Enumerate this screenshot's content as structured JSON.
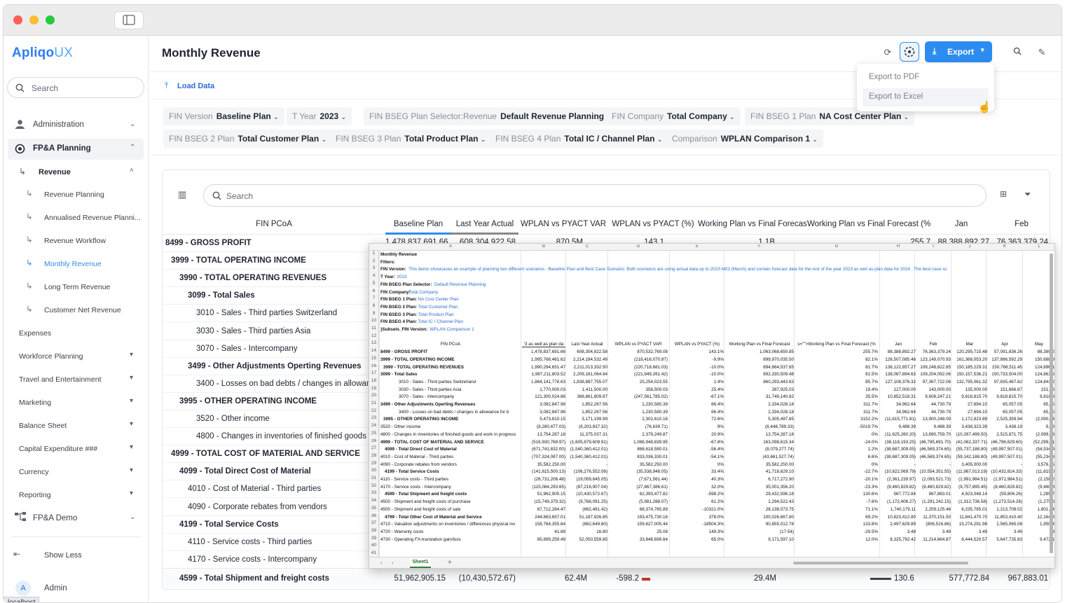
{
  "app": {
    "logo_main": "Apliqo",
    "logo_accent": "UX"
  },
  "sidebar": {
    "search_placeholder": "Search",
    "items": [
      {
        "label": "Administration"
      },
      {
        "label": "FP&A Planning"
      },
      {
        "label": "Revenue"
      },
      {
        "label": "Revenue Planning"
      },
      {
        "label": "Annualised Revenue Planni..."
      },
      {
        "label": "Revenue Workflow"
      },
      {
        "label": "Monthly Revenue"
      },
      {
        "label": "Long Term Revenue"
      },
      {
        "label": "Customer Net Revenue"
      },
      {
        "label": "Expenses"
      },
      {
        "label": "Workforce Planning"
      },
      {
        "label": "Travel and Entertainment"
      },
      {
        "label": "Marketing"
      },
      {
        "label": "Balance Sheet"
      },
      {
        "label": "Capital Expenditure ###"
      },
      {
        "label": "Currency"
      },
      {
        "label": "Reporting"
      },
      {
        "label": "FP&A Demo"
      }
    ],
    "show_less": "Show Less",
    "user_initial": "A",
    "user_name": "Admin"
  },
  "header": {
    "title": "Monthly Revenue",
    "export_label": "Export"
  },
  "export_menu": {
    "pdf": "Export to PDF",
    "excel": "Export to Excel"
  },
  "toolbar": {
    "load_data": "Load Data"
  },
  "filters": [
    {
      "key": "FIN Version",
      "value": "Baseline Plan"
    },
    {
      "key": "T Year",
      "value": "2023"
    },
    {
      "key": "FIN BSEG Plan Selector:Revenue",
      "value": "Default Revenue Planning"
    },
    {
      "key": "FIN Company",
      "value": "Total Company"
    },
    {
      "key": "FIN BSEG 1 Plan",
      "value": "NA Cost Center Plan"
    },
    {
      "key": "FIN BSEG 2 Plan",
      "value": "Total Customer Plan"
    },
    {
      "key": "FIN BSEG 3 Plan",
      "value": "Total Product Plan"
    },
    {
      "key": "FIN BSEG 4 Plan",
      "value": "Total IC / Channel Plan"
    },
    {
      "key": "Comparison",
      "value": "WPLAN Comparison 1"
    }
  ],
  "grid": {
    "search_placeholder": "Search",
    "columns": [
      "FIN PCoA",
      "Baseline Plan",
      "Last Year Actual",
      "WPLAN vs PYACT VAR",
      "WPLAN vs PYACT (%)",
      "Working Plan vs Final Forecast",
      "Working Plan vs Final Forecast (%)",
      "Jan",
      "Feb"
    ],
    "first_row_values": [
      "1,478,837,691.66",
      "608,304,922.58",
      "870.5M",
      "143.1",
      "1.1B",
      "255.7",
      "88,388,892.27",
      "76,363,379.24"
    ],
    "rows": [
      "8499 - GROSS PROFIT",
      "3999 - TOTAL OPERATING INCOME",
      "3990 - TOTAL OPERATING REVENUES",
      "3099 - Total Sales",
      "3010 - Sales - Third parties Switzerland",
      "3030 - Sales - Third parties Asia",
      "3070 - Sales - Intercompany",
      "3499 - Other Adjustments Operting Revenues",
      "3400 - Losses on bad debts / changes in allowance f",
      "3995 - OTHER OPERATING INCOME",
      "3520 - Other income",
      "4800 - Changes in inventories of finished goods and wo",
      "4999 - TOTAL COST OF MATERIAL AND SERVICE",
      "4099 - Total Direct Cost of Material",
      "4010 - Cost of Material - Third parties",
      "4090 - Corporate rebates from vendors",
      "4199 - Total Service Costs",
      "4110 - Service costs - Third parties",
      "4170 - Service costs - Intercompany",
      "4599 - Total Shipment and freight costs"
    ],
    "last_row_values": [
      "51,962,905.15",
      "(10,430,572.67)",
      "62.4M",
      "-598.2",
      "29.4M",
      "130.6",
      "577,772.84",
      "967,883.01"
    ]
  },
  "excel": {
    "title": "Monthly Revenue",
    "filters_label": "Filters:",
    "meta": [
      {
        "k": "FIN Version:",
        "v": "This demo showcases an example of planning two different scenarios - Baseline Plan and Best Case Scenario.  Both scenarios are using actual data up to 2023-M03 (March) and contain forecast data for the rest of the year 2023 as well as plan data for 2024 . The best case sc"
      },
      {
        "k": "T Year:",
        "v": "2023"
      },
      {
        "k": "FIN BSEG Plan Selector:",
        "v": "Default Revenue Planning"
      },
      {
        "k": "FIN Company:",
        "v": "Total Company"
      },
      {
        "k": "FIN BSEG 1 Plan:",
        "v": "NA Cost Center Plan"
      },
      {
        "k": "FIN BSEG 2 Plan:",
        "v": "Total Customer Plan"
      },
      {
        "k": "FIN BSEG 3 Plan:",
        "v": "Total Product Plan"
      },
      {
        "k": "FIN BSEG 4 Plan:",
        "v": "Total IC / Channel Plan"
      },
      {
        "k": "}Subsets_FIN Version:",
        "v": "WPLAN Comparison 1"
      }
    ],
    "col_letters": [
      "A",
      "B",
      "C",
      "D",
      "E",
      "F",
      "G",
      "H",
      "I",
      "J",
      "K",
      "L"
    ],
    "headers": [
      "FIN PCoA",
      "'3 as well as plan da",
      "Last Year Actual",
      "WPLAN vs PYACT VAR",
      "WPLAN vs PYACT (%)",
      "Working Plan vs Final Forecast",
      "s=\"\">Working Plan vs Final Forecast (%",
      "Jan",
      "Feb",
      "Mar",
      "Apr",
      "May"
    ],
    "rows": [
      [
        "8499 - GROSS PROFIT",
        "1,478,837,691.66",
        "608,304,922.58",
        "870,532,769.08",
        "143.1%",
        "1,063,068,650.85",
        "255.7%",
        "88,388,892.27",
        "76,363,379.24",
        "120,295,715.48",
        "57,091,836.26",
        "88,389,2"
      ],
      [
        "3999 - TOTAL OPERATING INCOME",
        "1,995,768,461.62",
        "2,214,184,532.49",
        "(218,416,070.87)",
        "-9.9%",
        "899,970,035.50",
        "82.1%",
        "126,507,085.46",
        "123,149,070.93",
        "161,368,053.20",
        "137,886,592.29",
        "150,688,9"
      ],
      [
        "3990 - TOTAL OPERATING REVENUES",
        "1,990,294,651.47",
        "2,211,013,332.50",
        "(220,718,681.03)",
        "-10.0%",
        "894,664,537.65",
        "81.7%",
        "138,122,857.27",
        "109,248,822.85",
        "150,185,229.31",
        "150,768,511.45",
        "124,896,1"
      ],
      [
        "3099 - Total Sales",
        "1,987,211,803.52",
        "2,209,161,064.94",
        "(221,949,261.42)",
        "-10.0%",
        "892,330,509.48",
        "81.5%",
        "138,087,894.63",
        "109,204,092.06",
        "150,157,536.21",
        "150,733,504.00",
        "124,861,5"
      ],
      [
        "3010 - Sales - Third parties Switzerland",
        "1,864,141,778.63",
        "1,838,887,755.07",
        "25,254,023.55",
        "1.4%",
        "860,293,443.63",
        "85.7%",
        "127,108,376.32",
        "97,367,722.06",
        "132,795,061.32",
        "97,835,467.62",
        "124,841,2"
      ],
      [
        "3030 - Sales - Third parties Asia",
        "1,770,000.03",
        "1,411,500.00",
        "358,500.03",
        "25.4%",
        "287,925.03",
        "19.4%",
        "127,000.00",
        "143,000.00",
        "135,000.00",
        "151,666.67",
        "151,66"
      ],
      [
        "3070 - Sales - Intercompany",
        "121,300,024.86",
        "368,861,809.87",
        "(247,561,785.02)",
        "-67.1%",
        "31,749,140.82",
        "35.5%",
        "10,852,518.31",
        "9,608,247.21",
        "9,818,815.70",
        "9,818,815.70",
        "9,818,8"
      ],
      [
        "3499 - Other Adjustments Operting Revenues",
        "3,082,847.96",
        "1,852,267.56",
        "1,230,580.39",
        "66.4%",
        "2,334,028.18",
        "311.7%",
        "34,962.64",
        "44,730.79",
        "27,694.10",
        "65,057.05",
        "65,05"
      ],
      [
        "3400 - Losses on bad debts / changes in allowance for b",
        "3,082,847.96",
        "1,852,267.56",
        "1,230,580.39",
        "66.4%",
        "2,334,028.18",
        "311.7%",
        "34,962.64",
        "44,730.79",
        "27,694.10",
        "65,057.05",
        "65,05"
      ],
      [
        "3995 - OTHER OPERATING INCOME",
        "5,473,810.15",
        "3,171,199.99",
        "2,302,610.16",
        "72.6%",
        "5,305,497.85",
        "3152.2%",
        "(11,615,771.81)",
        "13,900,248.09",
        "1,172,823.89",
        "2,525,359.94",
        "(2,090,14"
      ],
      [
        "3520 - Other income",
        "(8,280,477.03)",
        "(8,203,837.32)",
        "(76,639.71)",
        "9%",
        "(8,448,789.33)",
        "-5019.7%",
        "9,488.39",
        "9,488.39",
        "3,438,323.39",
        "3,438.19",
        "9,48"
      ],
      [
        "4800 - Changes in inventories of finished goods and work in progress",
        "13,754,287.18",
        "11,375,037.31",
        "2,379,249.87",
        "20.9%",
        "13,754,287.18",
        "0%",
        "(11,625,260.20)",
        "13,890,759.70",
        "(10,267,499.50)",
        "2,515,871.75",
        "(2,099,63"
      ],
      [
        "4999 - TOTAL COST OF MATERIAL AND SERVICE",
        "(516,930,769.97)",
        "(1,605,879,609.91)",
        "1,088,948,839.95",
        "-67.8%",
        "163,098,615.34",
        "-24.0%",
        "(38,118,193.25)",
        "(46,785,691.70)",
        "(41,062,337.71)",
        "(46,796,629.60)",
        "(52,299,71"
      ],
      [
        "4099 - Total Direct Cost of Material",
        "(671,741,832.00)",
        "(1,540,360,412.01)",
        "868,618,580.01",
        "-56.4%",
        "(8,079,277.74)",
        "1.2%",
        "(38,687,309.05)",
        "(46,569,374.65)",
        "(55,737,188.80)",
        "(49,997,507.01)",
        "(54,534,9"
      ],
      [
        "4010 - Cost of Material - Third parties",
        "(707,324,087.00)",
        "(1,540,360,412.01)",
        "833,036,330.01",
        "-54.1%",
        "(43,661,527.74)",
        "6.6%",
        "(38,687,309.05)",
        "(46,569,374.65)",
        "(59,142,188.80)",
        "(49,997,507.01)",
        "(55,234,9"
      ],
      [
        "4090 - Corporate rebates from vendors",
        "35,582,250.00",
        "-",
        "35,582,250.00",
        "0%",
        "35,582,250.00",
        "0%",
        "-",
        "-",
        "3,405,000.00",
        "-",
        "3,576,25"
      ],
      [
        "4199 - Total Service Costs",
        "(141,815,500.13)",
        "(106,276,552.08)",
        "(35,538,948.05)",
        "33.4%",
        "41,718,629.10",
        "-22.7%",
        "(10,822,069.79)",
        "(10,554,351.55)",
        "(11,967,013.19)",
        "(10,432,814.33)",
        "(11,619,0"
      ],
      [
        "4110 - Service costs - Third parties",
        "(26,731,206.48)",
        "(19,059,645.05)",
        "(7,671,561.44)",
        "40.3%",
        "6,717,272.90",
        "-20.1%",
        "(2,361,239.97)",
        "(2,093,521.73)",
        "(1,991,984.51)",
        "(1,971,984.51)",
        "(2,158,2"
      ],
      [
        "4170 - Service costs - Intercompany",
        "(115,084,293.65)",
        "(87,216,907.04)",
        "(27,867,386.61)",
        "32.0%",
        "35,001,356.20",
        "-23.3%",
        "(8,460,829.82)",
        "(8,460,829.82)",
        "(9,757,895.45)",
        "(8,460,829.82)",
        "(9,460,8"
      ],
      [
        "4599 - Total Shipment and freight costs",
        "51,962,905.15",
        "(10,430,572.67)",
        "62,393,477.82",
        "-598.2%",
        "29,432,596.18",
        "130.6%",
        "567,772.84",
        "967,883.01",
        "4,923,048.14",
        "(59,806.26)",
        "1,289,7"
      ],
      [
        "4500 - Shipment and freight costs of purchase",
        "(15,749,379.32)",
        "(9,768,091.25)",
        "(5,981,288.07)",
        "61.2%",
        "1,294,522.43",
        "-7.6%",
        "(1,172,406.27)",
        "(1,291,242.15)",
        "(1,312,736.58)",
        "(1,273,514.28)",
        "(1,275,6"
      ],
      [
        "4500 - Shipment and freight costs of sale",
        "67,712,284.47",
        "(662,481.42)",
        "68,374,765.89",
        "-10321.0%",
        "28,138,073.75",
        "71.1%",
        "1,740,179.11",
        "2,259,125.48",
        "6,235,785.01",
        "1,213,708.02",
        "1,801,74"
      ],
      [
        "4799 - Total Other Cost of Material and Service",
        "244,663,657.01",
        "51,187,926.85",
        "193,475,730.16",
        "378.0%",
        "100,026,667.80",
        "69.2%",
        "10,823,412.80",
        "11,370,151.50",
        "11,841,470.70",
        "11,853,410.40",
        "12,164,8"
      ],
      [
        "4710 - Valuation adjustments on inventories / differences physical inv",
        "158,764,355.64",
        "(862,649.80)",
        "159,627,005.44",
        "-18504.3%",
        "90,855,012.78",
        "133.8%",
        "2,497,629.89",
        "(806,516.86)",
        "15,274,291.98",
        "2,565,065.08",
        "1,950,4"
      ],
      [
        "4720 - Warranty costs",
        "41.88",
        "16.80",
        "25.08",
        "149.3%",
        "(17.54)",
        "-29.5%",
        "3.49",
        "3.49",
        "3.49",
        "3.49",
        "3"
      ],
      [
        "4730 - Operating FX-translation gain/loss",
        "85,899,259.49",
        "52,050,559.85",
        "33,848,699.64",
        "65.0%",
        "9,171,597.10",
        "12.0%",
        "8,325,792.42",
        "11,214,664.87",
        "6,444,520.57",
        "5,647,735.83",
        "9,472,1"
      ]
    ],
    "sheet_tab": "Sheet1"
  },
  "tooltip": "localhost",
  "colors": {
    "accent": "#2d8cf0",
    "logo": "#2f7df6",
    "bar_green": "#2ea84a",
    "bar_red": "#c0392b"
  }
}
